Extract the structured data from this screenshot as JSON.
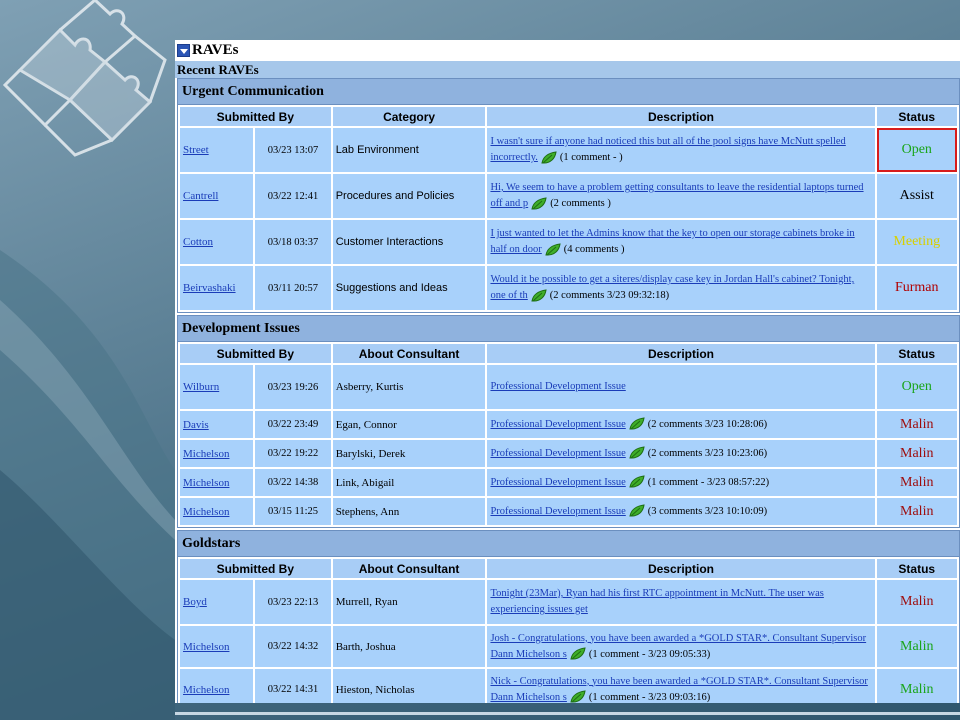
{
  "panel": {
    "title": "RAVEs",
    "subtitle": "Recent RAVEs"
  },
  "colors": {
    "open": "#1aa51a",
    "assist": "#000000",
    "meeting": "#d8d000",
    "furman": "#b00000",
    "malin_dark": "#9e0b0b",
    "malin_green": "#1aa51a",
    "link": "#1a3cb8",
    "cell": "#a8d1fb",
    "highlight": "#d81c1c"
  },
  "icons": {
    "toggle": "collapse-toggle-icon",
    "comment": "green-leaf-comment-icon"
  },
  "urgent": {
    "title": "Urgent Communication",
    "headers": [
      "Submitted By",
      "Category",
      "Description",
      "Status"
    ],
    "rows": [
      {
        "by": "Street",
        "date": "03/23 13:07",
        "cat": "Lab Environment",
        "desc": "I wasn't sure if anyone had noticed this but all of the pool signs have McNutt spelled incorrectly.",
        "comments": "(1 comment - )",
        "status": "Open",
        "status_color": "#1aa51a",
        "highlighted": true
      },
      {
        "by": "Cantrell",
        "date": "03/22 12:41",
        "cat": "Procedures and Policies",
        "desc": "Hi, We seem to have a problem getting consultants to leave the residential laptops turned off and p",
        "comments": "(2 comments )",
        "status": "Assist",
        "status_color": "#000000",
        "highlighted": false
      },
      {
        "by": "Cotton",
        "date": "03/18 03:37",
        "cat": "Customer Interactions",
        "desc": "I just wanted to let the Admins know that the key to open our storage cabinets broke in half on door",
        "comments": "(4 comments )",
        "status": "Meeting",
        "status_color": "#d8d000",
        "highlighted": false
      },
      {
        "by": "Beirvashaki",
        "date": "03/11 20:57",
        "cat": "Suggestions and Ideas",
        "desc": "Would it be possible to get a siteres/display case key in Jordan Hall's cabinet? Tonight, one of th",
        "comments": "(2 comments 3/23 09:32:18)",
        "status": "Furman",
        "status_color": "#b00000",
        "highlighted": false
      }
    ]
  },
  "development": {
    "title": "Development Issues",
    "headers": [
      "Submitted By",
      "About Consultant",
      "Description",
      "Status"
    ],
    "rows": [
      {
        "by": "Wilburn",
        "date": "03/23 19:26",
        "con": "Asberry, Kurtis",
        "desc": "Professional Development Issue",
        "comments": "",
        "status": "Open",
        "status_color": "#1aa51a"
      },
      {
        "by": "Davis",
        "date": "03/22 23:49",
        "con": "Egan, Connor",
        "desc": "Professional Development Issue",
        "comments": "(2 comments 3/23 10:28:06)",
        "status": "Malin",
        "status_color": "#9e0b0b"
      },
      {
        "by": "Michelson",
        "date": "03/22 19:22",
        "con": "Barylski, Derek",
        "desc": "Professional Development Issue",
        "comments": "(2 comments 3/23 10:23:06)",
        "status": "Malin",
        "status_color": "#9e0b0b"
      },
      {
        "by": "Michelson",
        "date": "03/22 14:38",
        "con": "Link, Abigail",
        "desc": "Professional Development Issue",
        "comments": "(1 comment - 3/23 08:57:22)",
        "status": "Malin",
        "status_color": "#9e0b0b"
      },
      {
        "by": "Michelson",
        "date": "03/15 11:25",
        "con": "Stephens, Ann",
        "desc": "Professional Development Issue",
        "comments": "(3 comments 3/23 10:10:09)",
        "status": "Malin",
        "status_color": "#9e0b0b"
      }
    ]
  },
  "goldstars": {
    "title": "Goldstars",
    "headers": [
      "Submitted By",
      "About Consultant",
      "Description",
      "Status"
    ],
    "rows": [
      {
        "by": "Boyd",
        "date": "03/23 22:13",
        "con": "Murrell, Ryan",
        "desc": "Tonight (23Mar), Ryan had his first RTC appointment in McNutt. The user was experiencing issues get",
        "comments": "",
        "status": "Malin",
        "status_color": "#9e0b0b"
      },
      {
        "by": "Michelson",
        "date": "03/22 14:32",
        "con": "Barth, Joshua",
        "desc": "Josh - Congratulations, you have been awarded a *GOLD STAR*. Consultant Supervisor Dann Michelson s",
        "comments": "(1 comment - 3/23 09:05:33)",
        "status": "Malin",
        "status_color": "#1aa51a"
      },
      {
        "by": "Michelson",
        "date": "03/22 14:31",
        "con": "Hieston, Nicholas",
        "desc": "Nick - Congratulations, you have been awarded a *GOLD STAR*. Consultant Supervisor Dann Michelson s",
        "comments": "(1 comment - 3/23 09:03:16)",
        "status": "Malin",
        "status_color": "#1aa51a"
      }
    ]
  }
}
